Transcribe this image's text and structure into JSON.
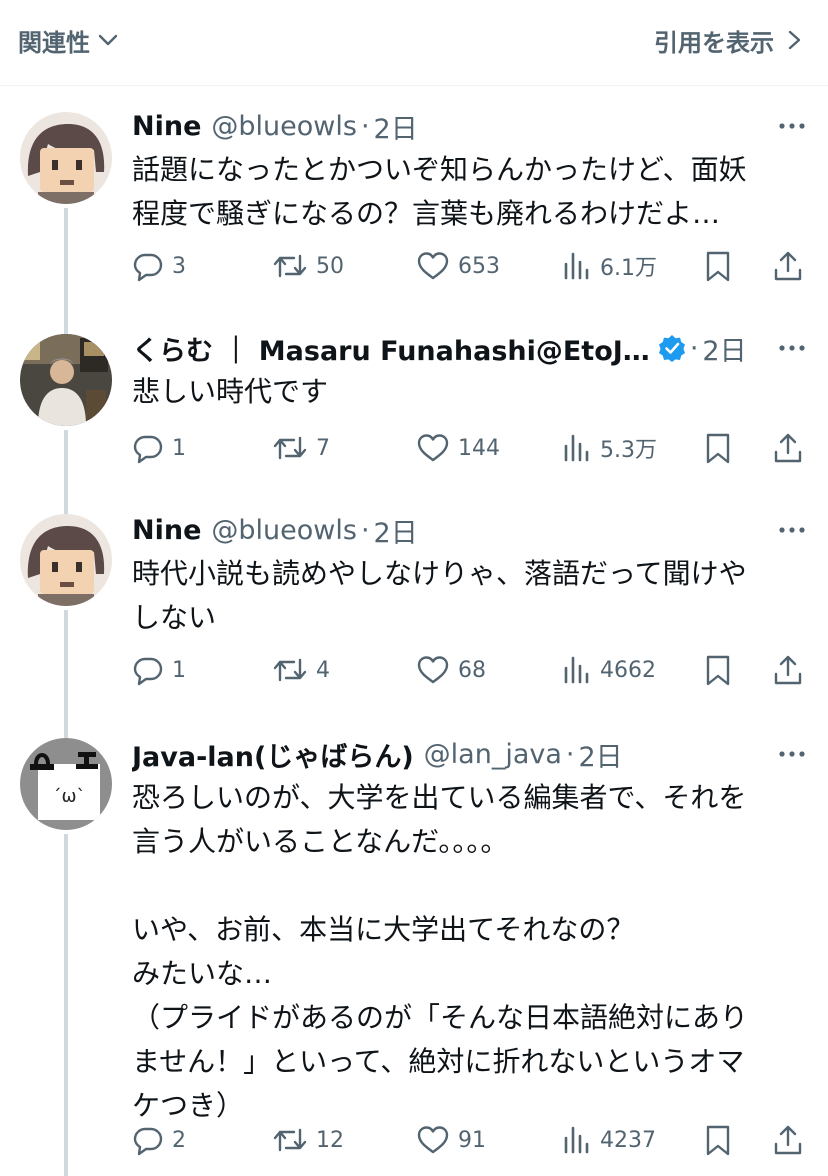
{
  "header": {
    "sort_label": "関連性",
    "quotes_label": "引用を表示"
  },
  "posts": [
    {
      "name": "Nine",
      "handle": "@blueowls",
      "dot": "·",
      "time": "2日",
      "verified": false,
      "lines": [
        "話題になったとかついぞ知らんかったけど、面妖",
        "程度で騒ぎになるの？言葉も廃れるわけだよ…"
      ],
      "replies": "3",
      "reposts": "50",
      "likes": "653",
      "views": "6.1万"
    },
    {
      "name": "くらむ ｜ Masaru Funahashi@EtoJ…",
      "handle": "",
      "dot": "·",
      "time": "2日",
      "verified": true,
      "lines": [
        "悲しい時代です"
      ],
      "replies": "1",
      "reposts": "7",
      "likes": "144",
      "views": "5.3万"
    },
    {
      "name": "Nine",
      "handle": "@blueowls",
      "dot": "·",
      "time": "2日",
      "verified": false,
      "lines": [
        "時代小説も読めやしなけりゃ、落語だって聞けや",
        "しない"
      ],
      "replies": "1",
      "reposts": "4",
      "likes": "68",
      "views": "4662"
    },
    {
      "name": "Java-lan(じゃばらん)",
      "handle": "@lan_java",
      "dot": "·",
      "time": "2日",
      "verified": false,
      "lines": [
        "恐ろしいのが、大学を出ている編集者で、それを",
        "言う人がいることなんだ。。。。",
        "",
        "いや、お前、本当に大学出てそれなの？",
        "みたいな…",
        "（プライドがあるのが「そんな日本語絶対にあり",
        "ません！」といって、絶対に折れないというオマ",
        "ケつき）"
      ],
      "replies": "2",
      "reposts": "12",
      "likes": "91",
      "views": "4237"
    }
  ],
  "icons": {
    "sort_chevron": "chevron-down-icon",
    "quotes_chevron": "chevron-right-icon",
    "more": "more-icon",
    "reply": "reply-icon",
    "repost": "repost-icon",
    "like": "heart-icon",
    "views": "views-icon",
    "bookmark": "bookmark-icon",
    "share": "share-icon",
    "verified": "verified-badge-icon"
  },
  "colors": {
    "text": "#0f1419",
    "secondary": "#536471",
    "verified": "#1d9bf0",
    "thread_line": "#cfd9de",
    "divider": "#eff3f4"
  }
}
